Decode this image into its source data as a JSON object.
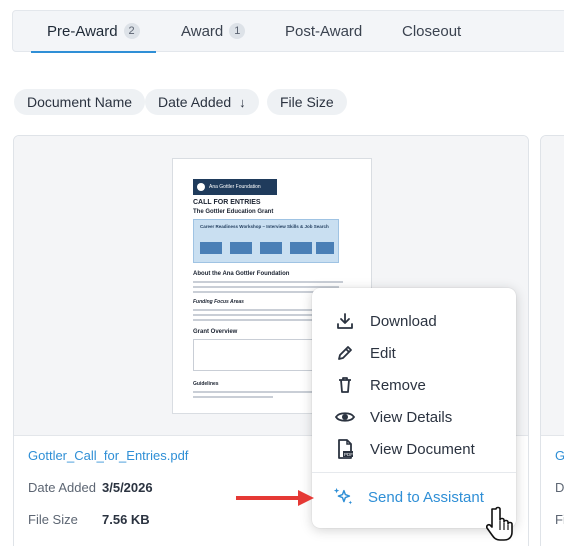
{
  "tabs": [
    {
      "label": "Pre-Award",
      "badge": "2"
    },
    {
      "label": "Award",
      "badge": "1"
    },
    {
      "label": "Post-Award",
      "badge": ""
    },
    {
      "label": "Closeout",
      "badge": ""
    }
  ],
  "sort": {
    "document_name": "Document Name",
    "date_added": "Date Added",
    "date_added_arrow": "↓",
    "file_size": "File Size"
  },
  "card": {
    "filename": "Gottler_Call_for_Entries.pdf",
    "date_added_label": "Date Added",
    "date_added_value": "3/5/2026",
    "file_size_label": "File Size",
    "file_size_value": "7.56 KB",
    "preview": {
      "org": "Ana Gottler Foundation",
      "title": "CALL FOR ENTRIES",
      "subtitle": "The Gottler Education Grant",
      "band_text": "Career Readiness Workshop – Interview Skills & Job Search",
      "about": "About the Ana Gottler Foundation",
      "focus": "Funding Focus Areas",
      "overview": "Grant Overview",
      "guidelines": "Guidelines"
    }
  },
  "card2": {
    "link_fragment": "G",
    "d_fragment": "D",
    "f_fragment": "Fi"
  },
  "menu": {
    "items": [
      {
        "label": "Download",
        "icon": "download-icon"
      },
      {
        "label": "Edit",
        "icon": "pencil-icon"
      },
      {
        "label": "Remove",
        "icon": "trash-icon"
      },
      {
        "label": "View Details",
        "icon": "eye-icon"
      },
      {
        "label": "View Document",
        "icon": "pdf-icon"
      }
    ],
    "assistant": {
      "label": "Send to Assistant",
      "icon": "sparkle-icon"
    }
  },
  "colors": {
    "accent": "#2f8fd6",
    "annotation_arrow": "#e53935"
  }
}
